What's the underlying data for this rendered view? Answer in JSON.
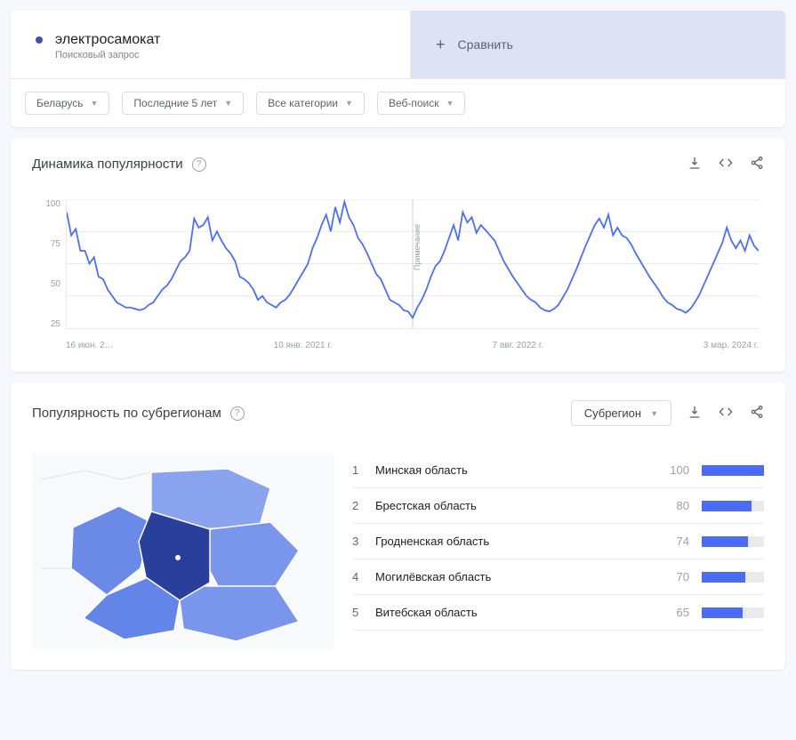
{
  "query": {
    "term": "электросамокат",
    "type": "Поисковый запрос"
  },
  "compare": {
    "label": "Сравнить"
  },
  "filters": {
    "geo": "Беларусь",
    "time": "Последние 5 лет",
    "category": "Все категории",
    "search_type": "Веб-поиск"
  },
  "interest_card": {
    "title": "Динамика популярности",
    "note": "Примечание"
  },
  "regions_card": {
    "title": "Популярность по субрегионам",
    "dropdown": "Субрегион"
  },
  "regions": [
    {
      "rank": "1",
      "name": "Минская область",
      "value": "100",
      "bar": 100
    },
    {
      "rank": "2",
      "name": "Брестская область",
      "value": "80",
      "bar": 80
    },
    {
      "rank": "3",
      "name": "Гродненская область",
      "value": "74",
      "bar": 74
    },
    {
      "rank": "4",
      "name": "Могилёвская область",
      "value": "70",
      "bar": 70
    },
    {
      "rank": "5",
      "name": "Витебская область",
      "value": "65",
      "bar": 65
    }
  ],
  "chart_data": {
    "type": "line",
    "title": "Динамика популярности",
    "xlabel": "",
    "ylabel": "",
    "ylim": [
      0,
      100
    ],
    "y_ticks": [
      "100",
      "75",
      "50",
      "25"
    ],
    "x_ticks": [
      "16 июн. 2…",
      "10 янв. 2021 г.",
      "7 авг. 2022 г.",
      "3 мар. 2024 г."
    ],
    "values": [
      90,
      72,
      77,
      60,
      60,
      50,
      55,
      40,
      38,
      30,
      25,
      20,
      18,
      16,
      16,
      15,
      14,
      15,
      18,
      20,
      25,
      30,
      33,
      38,
      45,
      52,
      55,
      60,
      85,
      78,
      80,
      86,
      68,
      75,
      68,
      62,
      58,
      52,
      40,
      38,
      35,
      30,
      22,
      25,
      20,
      18,
      16,
      20,
      22,
      26,
      32,
      38,
      44,
      50,
      62,
      70,
      80,
      88,
      75,
      94,
      82,
      98,
      86,
      80,
      70,
      65,
      58,
      50,
      42,
      38,
      30,
      22,
      20,
      18,
      14,
      13,
      8,
      16,
      22,
      30,
      40,
      48,
      52,
      60,
      70,
      80,
      68,
      90,
      82,
      86,
      74,
      80,
      76,
      72,
      68,
      60,
      52,
      46,
      40,
      35,
      30,
      25,
      22,
      20,
      16,
      14,
      13,
      15,
      18,
      24,
      30,
      38,
      46,
      55,
      64,
      72,
      80,
      85,
      78,
      88,
      72,
      78,
      72,
      70,
      65,
      58,
      52,
      46,
      40,
      35,
      30,
      24,
      20,
      18,
      15,
      14,
      12,
      15,
      20,
      26,
      34,
      42,
      50,
      58,
      66,
      78,
      68,
      62,
      68,
      60,
      72,
      64,
      60
    ]
  }
}
